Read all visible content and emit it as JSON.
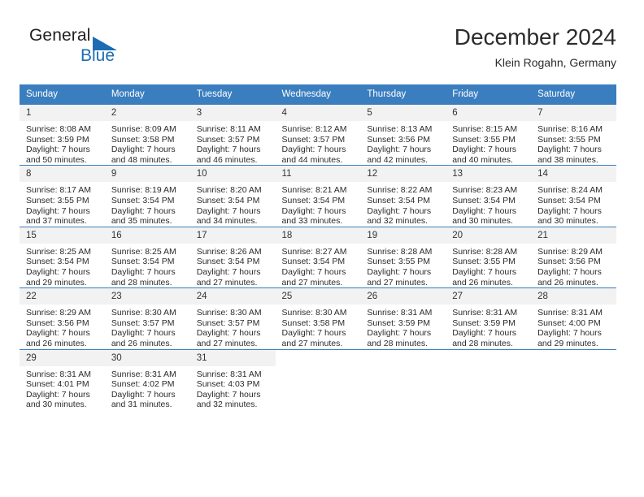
{
  "brand": {
    "name_part1": "General",
    "name_part2": "Blue",
    "triangle_color": "#1c6cb4"
  },
  "header": {
    "month_title": "December 2024",
    "location": "Klein Rogahn, Germany"
  },
  "theme": {
    "header_bg": "#3a7ebf",
    "daynum_bg": "#f2f2f2",
    "grid_line": "#3a7ebf"
  },
  "weekdays": [
    "Sunday",
    "Monday",
    "Tuesday",
    "Wednesday",
    "Thursday",
    "Friday",
    "Saturday"
  ],
  "weeks": [
    [
      {
        "day": "1",
        "sunrise": "Sunrise: 8:08 AM",
        "sunset": "Sunset: 3:59 PM",
        "daylight1": "Daylight: 7 hours",
        "daylight2": "and 50 minutes."
      },
      {
        "day": "2",
        "sunrise": "Sunrise: 8:09 AM",
        "sunset": "Sunset: 3:58 PM",
        "daylight1": "Daylight: 7 hours",
        "daylight2": "and 48 minutes."
      },
      {
        "day": "3",
        "sunrise": "Sunrise: 8:11 AM",
        "sunset": "Sunset: 3:57 PM",
        "daylight1": "Daylight: 7 hours",
        "daylight2": "and 46 minutes."
      },
      {
        "day": "4",
        "sunrise": "Sunrise: 8:12 AM",
        "sunset": "Sunset: 3:57 PM",
        "daylight1": "Daylight: 7 hours",
        "daylight2": "and 44 minutes."
      },
      {
        "day": "5",
        "sunrise": "Sunrise: 8:13 AM",
        "sunset": "Sunset: 3:56 PM",
        "daylight1": "Daylight: 7 hours",
        "daylight2": "and 42 minutes."
      },
      {
        "day": "6",
        "sunrise": "Sunrise: 8:15 AM",
        "sunset": "Sunset: 3:55 PM",
        "daylight1": "Daylight: 7 hours",
        "daylight2": "and 40 minutes."
      },
      {
        "day": "7",
        "sunrise": "Sunrise: 8:16 AM",
        "sunset": "Sunset: 3:55 PM",
        "daylight1": "Daylight: 7 hours",
        "daylight2": "and 38 minutes."
      }
    ],
    [
      {
        "day": "8",
        "sunrise": "Sunrise: 8:17 AM",
        "sunset": "Sunset: 3:55 PM",
        "daylight1": "Daylight: 7 hours",
        "daylight2": "and 37 minutes."
      },
      {
        "day": "9",
        "sunrise": "Sunrise: 8:19 AM",
        "sunset": "Sunset: 3:54 PM",
        "daylight1": "Daylight: 7 hours",
        "daylight2": "and 35 minutes."
      },
      {
        "day": "10",
        "sunrise": "Sunrise: 8:20 AM",
        "sunset": "Sunset: 3:54 PM",
        "daylight1": "Daylight: 7 hours",
        "daylight2": "and 34 minutes."
      },
      {
        "day": "11",
        "sunrise": "Sunrise: 8:21 AM",
        "sunset": "Sunset: 3:54 PM",
        "daylight1": "Daylight: 7 hours",
        "daylight2": "and 33 minutes."
      },
      {
        "day": "12",
        "sunrise": "Sunrise: 8:22 AM",
        "sunset": "Sunset: 3:54 PM",
        "daylight1": "Daylight: 7 hours",
        "daylight2": "and 32 minutes."
      },
      {
        "day": "13",
        "sunrise": "Sunrise: 8:23 AM",
        "sunset": "Sunset: 3:54 PM",
        "daylight1": "Daylight: 7 hours",
        "daylight2": "and 30 minutes."
      },
      {
        "day": "14",
        "sunrise": "Sunrise: 8:24 AM",
        "sunset": "Sunset: 3:54 PM",
        "daylight1": "Daylight: 7 hours",
        "daylight2": "and 30 minutes."
      }
    ],
    [
      {
        "day": "15",
        "sunrise": "Sunrise: 8:25 AM",
        "sunset": "Sunset: 3:54 PM",
        "daylight1": "Daylight: 7 hours",
        "daylight2": "and 29 minutes."
      },
      {
        "day": "16",
        "sunrise": "Sunrise: 8:25 AM",
        "sunset": "Sunset: 3:54 PM",
        "daylight1": "Daylight: 7 hours",
        "daylight2": "and 28 minutes."
      },
      {
        "day": "17",
        "sunrise": "Sunrise: 8:26 AM",
        "sunset": "Sunset: 3:54 PM",
        "daylight1": "Daylight: 7 hours",
        "daylight2": "and 27 minutes."
      },
      {
        "day": "18",
        "sunrise": "Sunrise: 8:27 AM",
        "sunset": "Sunset: 3:54 PM",
        "daylight1": "Daylight: 7 hours",
        "daylight2": "and 27 minutes."
      },
      {
        "day": "19",
        "sunrise": "Sunrise: 8:28 AM",
        "sunset": "Sunset: 3:55 PM",
        "daylight1": "Daylight: 7 hours",
        "daylight2": "and 27 minutes."
      },
      {
        "day": "20",
        "sunrise": "Sunrise: 8:28 AM",
        "sunset": "Sunset: 3:55 PM",
        "daylight1": "Daylight: 7 hours",
        "daylight2": "and 26 minutes."
      },
      {
        "day": "21",
        "sunrise": "Sunrise: 8:29 AM",
        "sunset": "Sunset: 3:56 PM",
        "daylight1": "Daylight: 7 hours",
        "daylight2": "and 26 minutes."
      }
    ],
    [
      {
        "day": "22",
        "sunrise": "Sunrise: 8:29 AM",
        "sunset": "Sunset: 3:56 PM",
        "daylight1": "Daylight: 7 hours",
        "daylight2": "and 26 minutes."
      },
      {
        "day": "23",
        "sunrise": "Sunrise: 8:30 AM",
        "sunset": "Sunset: 3:57 PM",
        "daylight1": "Daylight: 7 hours",
        "daylight2": "and 26 minutes."
      },
      {
        "day": "24",
        "sunrise": "Sunrise: 8:30 AM",
        "sunset": "Sunset: 3:57 PM",
        "daylight1": "Daylight: 7 hours",
        "daylight2": "and 27 minutes."
      },
      {
        "day": "25",
        "sunrise": "Sunrise: 8:30 AM",
        "sunset": "Sunset: 3:58 PM",
        "daylight1": "Daylight: 7 hours",
        "daylight2": "and 27 minutes."
      },
      {
        "day": "26",
        "sunrise": "Sunrise: 8:31 AM",
        "sunset": "Sunset: 3:59 PM",
        "daylight1": "Daylight: 7 hours",
        "daylight2": "and 28 minutes."
      },
      {
        "day": "27",
        "sunrise": "Sunrise: 8:31 AM",
        "sunset": "Sunset: 3:59 PM",
        "daylight1": "Daylight: 7 hours",
        "daylight2": "and 28 minutes."
      },
      {
        "day": "28",
        "sunrise": "Sunrise: 8:31 AM",
        "sunset": "Sunset: 4:00 PM",
        "daylight1": "Daylight: 7 hours",
        "daylight2": "and 29 minutes."
      }
    ],
    [
      {
        "day": "29",
        "sunrise": "Sunrise: 8:31 AM",
        "sunset": "Sunset: 4:01 PM",
        "daylight1": "Daylight: 7 hours",
        "daylight2": "and 30 minutes."
      },
      {
        "day": "30",
        "sunrise": "Sunrise: 8:31 AM",
        "sunset": "Sunset: 4:02 PM",
        "daylight1": "Daylight: 7 hours",
        "daylight2": "and 31 minutes."
      },
      {
        "day": "31",
        "sunrise": "Sunrise: 8:31 AM",
        "sunset": "Sunset: 4:03 PM",
        "daylight1": "Daylight: 7 hours",
        "daylight2": "and 32 minutes."
      },
      {
        "day": "",
        "sunrise": "",
        "sunset": "",
        "daylight1": "",
        "daylight2": ""
      },
      {
        "day": "",
        "sunrise": "",
        "sunset": "",
        "daylight1": "",
        "daylight2": ""
      },
      {
        "day": "",
        "sunrise": "",
        "sunset": "",
        "daylight1": "",
        "daylight2": ""
      },
      {
        "day": "",
        "sunrise": "",
        "sunset": "",
        "daylight1": "",
        "daylight2": ""
      }
    ]
  ]
}
